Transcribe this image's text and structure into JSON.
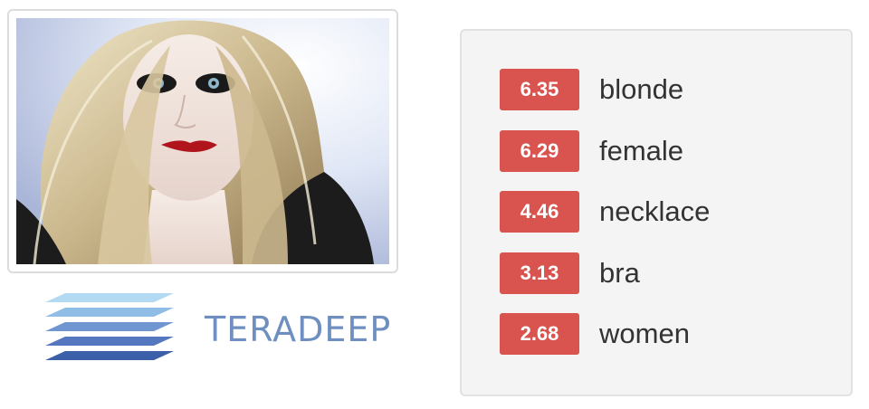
{
  "photo": {
    "icon": "portrait-photo"
  },
  "logo": {
    "text": "TERADEEP",
    "mark_icon": "stacked-layers-icon",
    "colors": {
      "word": "#6e8fbf",
      "layers": [
        "#3b5fa8",
        "#5577c0",
        "#6f96d0",
        "#8fbde6",
        "#b3daf2"
      ]
    }
  },
  "tags": [
    {
      "score": "6.35",
      "label": "blonde"
    },
    {
      "score": "6.29",
      "label": "female"
    },
    {
      "score": "4.46",
      "label": "necklace"
    },
    {
      "score": "3.13",
      "label": "bra"
    },
    {
      "score": "2.68",
      "label": "women"
    }
  ],
  "colors": {
    "badge": "#d9534f",
    "panel": "#f4f4f4"
  }
}
